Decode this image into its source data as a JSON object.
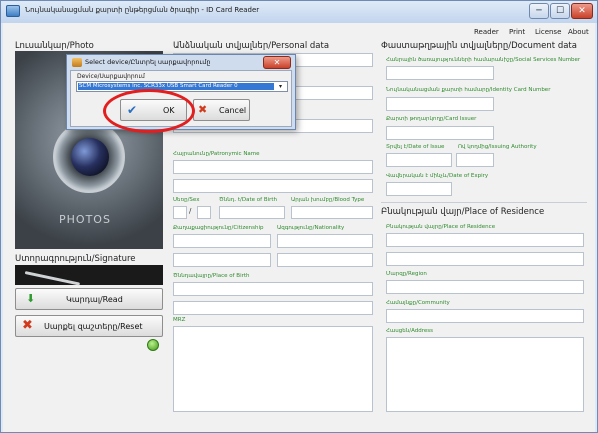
{
  "window": {
    "title": "Նույնականացման քարտի ընթերցման ծրագիր - ID Card Reader",
    "min_symbol": "─",
    "max_symbol": "☐",
    "close_symbol": "✕"
  },
  "menu": {
    "items": [
      {
        "label": "Reader"
      },
      {
        "label": "Print"
      },
      {
        "label": "License"
      },
      {
        "label": "About"
      }
    ]
  },
  "left_panel": {
    "photo_title": "Լուսանկար/Photo",
    "photo_placeholder": "PHOTOS",
    "signature_title": "Ստորագրություն/Signature",
    "read_button": "Կարդալ/Read",
    "reset_button": "Սարքել զաշտերը/Reset"
  },
  "personal": {
    "title": "Անձնական տվյալներ/Personal data",
    "patronymic_label": "Հայրանունը/Patronymic Name",
    "sex_label": "Սեռը/Sex",
    "dob_label": "Ծննդ. t/Date of Birth",
    "blood_label": "Արյան խումբը/Blood Type",
    "dob_sep_1": "/",
    "dob_sep_2": "/",
    "citizenship_label": "Քաղաքացիությունը/Citizenship",
    "nationality_label": "Ազգությունը/Nationality",
    "pob_label": "Ծննդավայրը/Place of Birth",
    "mrz_label": "MRZ"
  },
  "document": {
    "title": "Փաստաթղթային տվյալները/Document data",
    "ssn_label": "Հանրային ծառայությունների համարանիշը/Social Services Number",
    "idcard_label": "Նույնականացման քարտի համարը/Identity Card Number",
    "issuer_label": "Քարտի թողարկողը/Card Issuer",
    "doi_label": "Տրվել է/Date of Issue",
    "authority_label": "Ով կողմից/Issuing Authority",
    "expiry_label": "Վավերական է մինչև/Date of Expiry"
  },
  "residence": {
    "title": "Բնակության վայր/Place of Residence",
    "por_label": "Բնակության վայրը/Place of Residence",
    "region_label": "Մարզը/Region",
    "community_label": "Համայնքը/Community",
    "address_label": "Հասցեն/Address"
  },
  "dialog": {
    "title": "Select device/Ընտրել սարքավորումը",
    "device_label": "Device/Սարքավորում",
    "selected_device": "SCM Microsystems Inc. SCR33x USB Smart Card Reader 0",
    "ok_label": "OK",
    "cancel_label": "Cancel",
    "close_symbol": "✕",
    "annotation_color": "#e21e1e"
  },
  "colors": {
    "label_green": "#2e8a2e",
    "selection_blue": "#3478d3"
  }
}
